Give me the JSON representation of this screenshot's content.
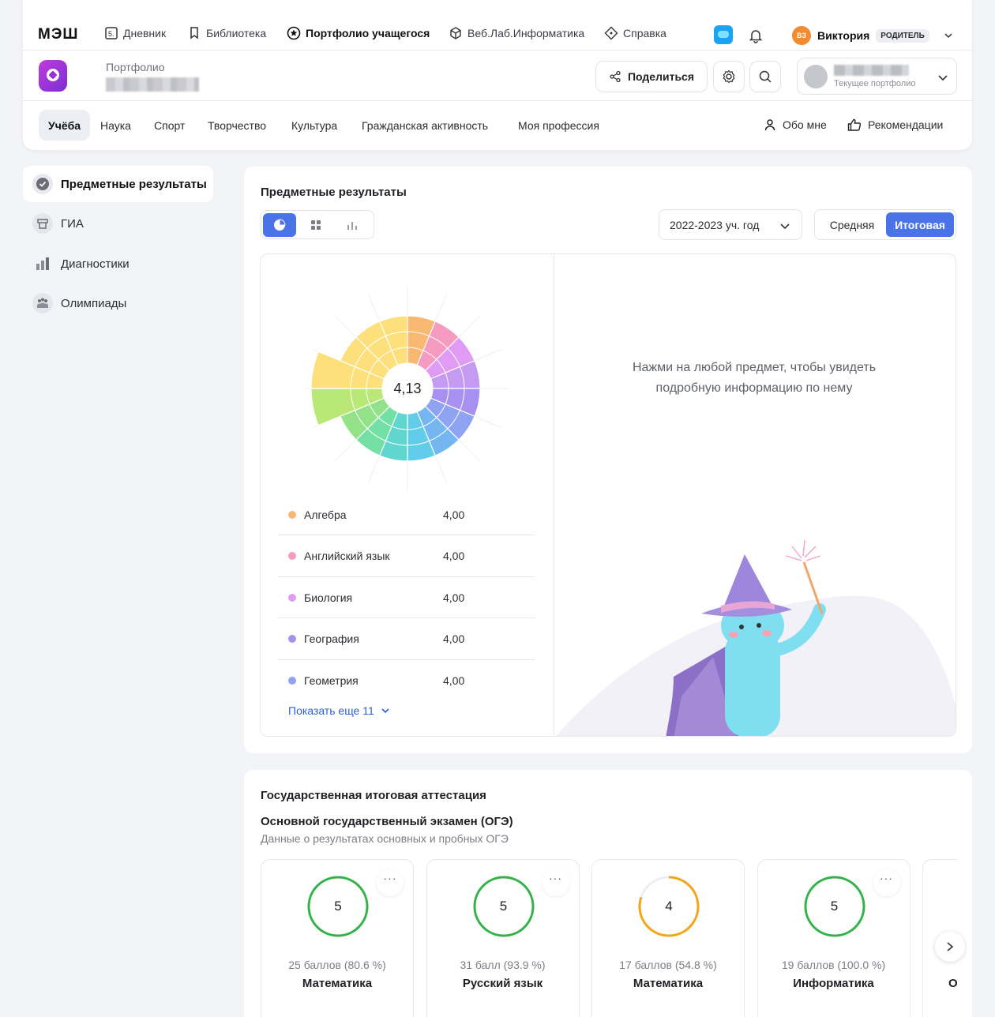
{
  "header": {
    "logo": "МЭШ",
    "nav": [
      {
        "label": "Дневник",
        "icon": "diary-icon"
      },
      {
        "label": "Библиотека",
        "icon": "library-icon"
      },
      {
        "label": "Портфолио учащегося",
        "icon": "star-circle-icon",
        "active": true
      },
      {
        "label": "Веб.Лаб.Информатика",
        "icon": "cube-icon"
      },
      {
        "label": "Справка",
        "icon": "help-diamond-icon"
      }
    ],
    "user": {
      "initials": "ВЗ",
      "name": "Виктория",
      "role": "РОДИТЕЛЬ"
    }
  },
  "portfolio": {
    "title": "Портфолио",
    "share_label": "Поделиться",
    "current_portfolio_label": "Текущее портфолио"
  },
  "tabs": [
    "Учёба",
    "Наука",
    "Спорт",
    "Творчество",
    "Культура",
    "Гражданская активность",
    "Моя профессия"
  ],
  "tabs_right": [
    {
      "label": "Обо мне",
      "icon": "person-icon"
    },
    {
      "label": "Рекомендации",
      "icon": "thumbs-up-icon"
    }
  ],
  "sidebar": [
    {
      "label": "Предметные результаты",
      "icon": "check-circle-icon",
      "active": true
    },
    {
      "label": "ГИА",
      "icon": "gia-icon"
    },
    {
      "label": "Диагностики",
      "icon": "bar-chart-icon"
    },
    {
      "label": "Олимпиады",
      "icon": "people-icon"
    }
  ],
  "subjects_card": {
    "title": "Предметные результаты",
    "year": "2022-2023 уч. год",
    "segments": [
      "Средняя",
      "Итоговая"
    ],
    "active_segment": "Итоговая",
    "average": "4,13",
    "hint": "Нажми на любой предмет, чтобы увидеть подробную информацию по нему",
    "show_more": "Показать еще 11",
    "subjects": [
      {
        "name": "Алгебра",
        "value": "4,00",
        "color": "#f9b872"
      },
      {
        "name": "Английский язык",
        "value": "4,00",
        "color": "#f59ac0"
      },
      {
        "name": "Биология",
        "value": "4,00",
        "color": "#df9cf2"
      },
      {
        "name": "География",
        "value": "4,00",
        "color": "#a890f0"
      },
      {
        "name": "Геометрия",
        "value": "4,00",
        "color": "#8ea3f2"
      }
    ]
  },
  "gia_card": {
    "title": "Государственная итоговая аттестация",
    "subtitle": "Основной государственный экзамен (ОГЭ)",
    "description": "Данные о результатах основных и пробных ОГЭ",
    "exams": [
      {
        "grade": "5",
        "score": "25 баллов (80.6 %)",
        "subject": "Математика",
        "color": "#34b24a"
      },
      {
        "grade": "5",
        "score": "31 балл (93.9 %)",
        "subject": "Русский язык",
        "color": "#34b24a"
      },
      {
        "grade": "4",
        "score": "17 баллов (54.8 %)",
        "subject": "Математика",
        "color": "#f2a516"
      },
      {
        "grade": "5",
        "score": "19 баллов (100.0 %)",
        "subject": "Информатика",
        "color": "#34b24a"
      },
      {
        "grade": "",
        "score": "",
        "subject": "О",
        "color": "#34b24a"
      }
    ]
  }
}
